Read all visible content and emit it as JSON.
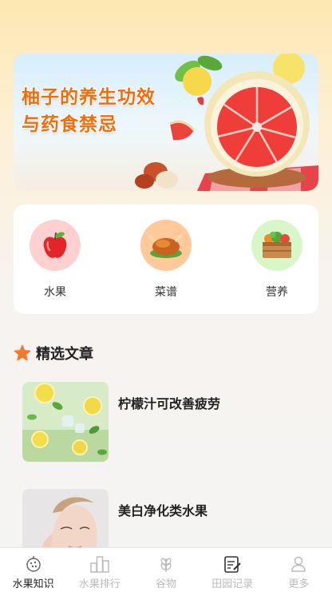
{
  "banner": {
    "line1": "柚子的养生功效",
    "line2": "与药食禁忌"
  },
  "categories": [
    {
      "label": "水果",
      "icon": "apple-icon",
      "bg": "#ffd0d0"
    },
    {
      "label": "菜谱",
      "icon": "roast-chicken-icon",
      "bg": "#ffc99a"
    },
    {
      "label": "营养",
      "icon": "vegetable-crate-icon",
      "bg": "#d7f7c8"
    }
  ],
  "section": {
    "title": "精选文章"
  },
  "articles": [
    {
      "title": "柠檬汁可改善疲劳"
    },
    {
      "title": "美白净化类水果"
    }
  ],
  "tabs": [
    {
      "label": "水果知识",
      "icon": "fruit-knowledge-icon",
      "active": true
    },
    {
      "label": "水果排行",
      "icon": "ranking-icon",
      "active": false
    },
    {
      "label": "谷物",
      "icon": "grain-icon",
      "active": false
    },
    {
      "label": "田园记录",
      "icon": "notes-icon",
      "active": false
    },
    {
      "label": "更多",
      "icon": "profile-icon",
      "active": false
    }
  ],
  "colors": {
    "headline": "#f26d0c",
    "star": "#f07a2c",
    "active_tab": "#222222",
    "inactive_tab": "#bbbbbb"
  }
}
